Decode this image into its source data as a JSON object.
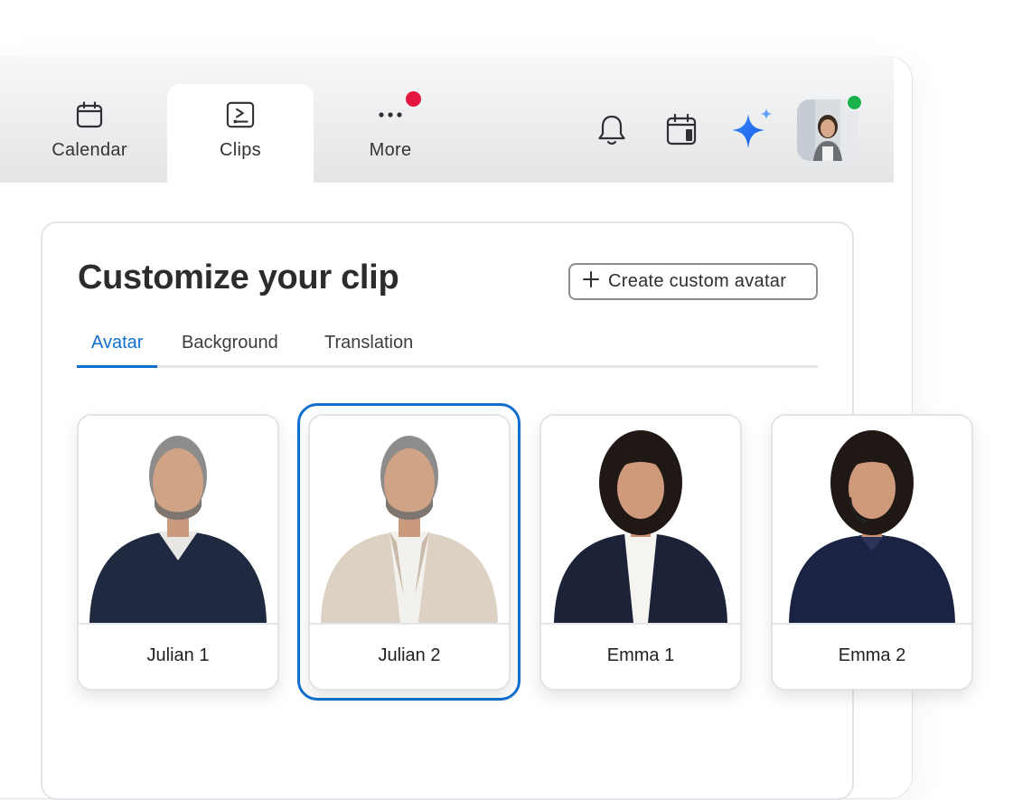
{
  "nav": {
    "tabs": [
      {
        "label": "Calendar",
        "icon": "calendar-icon"
      },
      {
        "label": "Clips",
        "icon": "clips-icon"
      },
      {
        "label": "More",
        "icon": "more-icon"
      }
    ],
    "active_tab": "Clips"
  },
  "topbar_icons": [
    "bell-icon",
    "calendar-side-icon",
    "ai-sparkle-icon"
  ],
  "panel": {
    "title": "Customize your clip",
    "create_button": "Create custom avatar",
    "tabs": [
      "Avatar",
      "Background",
      "Translation"
    ],
    "active_tab": "Avatar"
  },
  "avatars": [
    {
      "name": "Julian 1"
    },
    {
      "name": "Julian 2"
    },
    {
      "name": "Emma 1"
    },
    {
      "name": "Emma 2"
    }
  ],
  "selected_avatar": "Julian 2",
  "colors": {
    "accent": "#1170cf",
    "notification": "#e3173f",
    "presence": "#19b349"
  }
}
